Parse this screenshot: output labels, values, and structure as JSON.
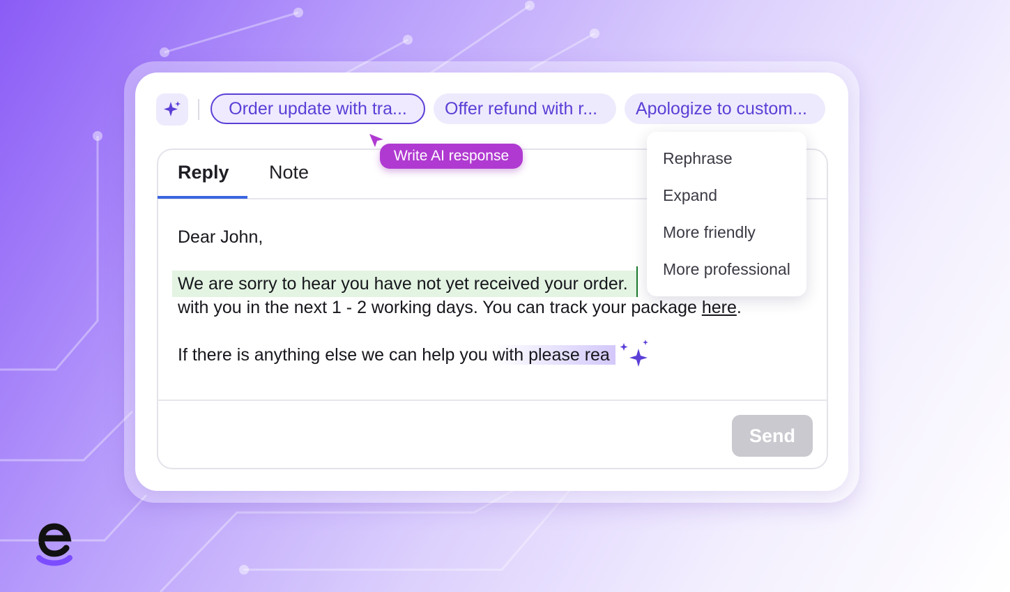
{
  "colors": {
    "brand_purple": "#5b3fd6",
    "tooltip_magenta": "#b03ad1",
    "highlight_green": "#e3f4e2",
    "tab_underline_blue": "#3b66e0",
    "send_disabled_gray": "#c9c9cf"
  },
  "suggestions": {
    "ai_icon": "sparkle-icon",
    "chips": [
      {
        "label": "Order update with tra...",
        "active": true
      },
      {
        "label": "Offer refund with r...",
        "active": false
      },
      {
        "label": "Apologize to custom...",
        "active": false
      }
    ]
  },
  "tooltip": {
    "label": "Write AI response"
  },
  "tabs": {
    "reply": "Reply",
    "note": "Note"
  },
  "message": {
    "greeting": "Dear John,",
    "highlighted_sentence": "We are sorry to hear you have not yet received your order.",
    "line2_text": "with you in the next 1 - 2 working days. You can track your package ",
    "link_text": "here",
    "line2_end": ".",
    "line3_text": "If there is anything else we can help you ",
    "line3_fading": "with please rea"
  },
  "send_button": {
    "label": "Send"
  },
  "rewrite_menu": {
    "items": [
      "Rephrase",
      "Expand",
      "More friendly",
      "More professional"
    ]
  }
}
